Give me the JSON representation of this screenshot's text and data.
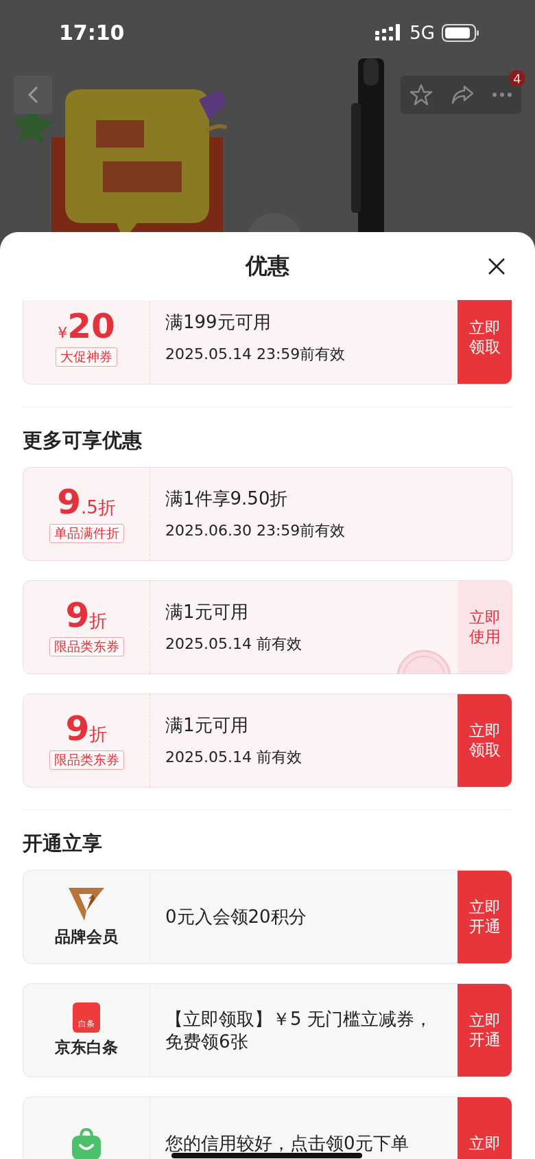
{
  "status_bar": {
    "time": "17:10",
    "network": "5G"
  },
  "nav": {
    "badge": "4"
  },
  "sheet": {
    "title": "优惠"
  },
  "sections": [
    {
      "items": [
        {
          "kind": "coupon",
          "prefix": "¥",
          "value": "20",
          "tag": "大促神券",
          "condition": "满199元可用",
          "validity": "2025.05.14 23:59前有效",
          "button": {
            "kind": "claim",
            "label": "立即领取"
          },
          "claimed": false
        }
      ]
    },
    {
      "title": "更多可享优惠",
      "items": [
        {
          "kind": "coupon",
          "value": "9",
          "suffix": ".5折",
          "tag": "单品满件折",
          "condition": "满1件享9.50折",
          "validity": "2025.06.30 23:59前有效",
          "claimed": false
        },
        {
          "kind": "coupon",
          "value": "9",
          "suffix": "折",
          "tag": "限品类东券",
          "condition": "满1元可用",
          "validity": "2025.05.14 前有效",
          "button": {
            "kind": "use",
            "label": "立即使用"
          },
          "claimed": true
        },
        {
          "kind": "coupon",
          "value": "9",
          "suffix": "折",
          "tag": "限品类东券",
          "condition": "满1元可用",
          "validity": "2025.05.14 前有效",
          "button": {
            "kind": "claim",
            "label": "立即领取"
          },
          "claimed": false
        }
      ]
    },
    {
      "title": "开通立享",
      "items": [
        {
          "kind": "member",
          "name": "品牌会员",
          "text": "0元入会领20积分",
          "button": {
            "kind": "claim",
            "label": "立即开通"
          }
        },
        {
          "kind": "member",
          "icon_text": "白条",
          "name": "京东白条",
          "text": "【立即领取】￥5 无门槛立减券，免费领6张",
          "button": {
            "kind": "claim",
            "label": "立即开通"
          }
        },
        {
          "kind": "member",
          "text": "您的信用较好，点击领0元下单",
          "button": {
            "kind": "claim",
            "label": "立即"
          }
        }
      ]
    }
  ]
}
